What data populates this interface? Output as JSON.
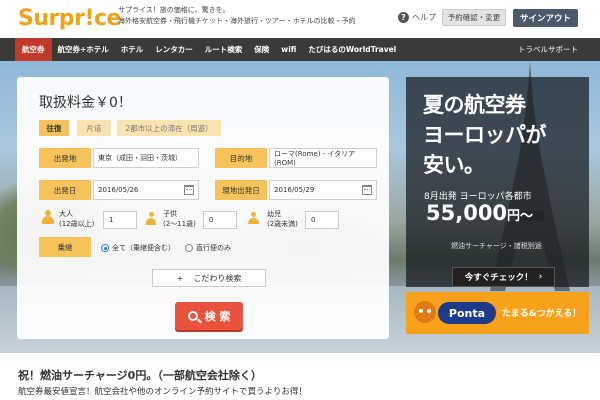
{
  "header": {
    "logo": "Surpr!ce",
    "tagline_1": "サプライス！旅の価格に、驚きを。",
    "tagline_2": "海外格安航空券・飛行機チケット・海外旅行・ツアー・ホテルの比較・予約",
    "help": "ヘルプ",
    "booking_button": "予約確認・変更",
    "signout_button": "サインアウト"
  },
  "nav": {
    "items": [
      "航空券",
      "航空券+ホテル",
      "ホテル",
      "レンタカー",
      "ルート検索",
      "保険",
      "wifi",
      "たびはるのWorldTravel"
    ],
    "support": "トラベルサポート"
  },
  "search": {
    "price_title": "取扱料金￥0！",
    "trip_tabs": [
      "往復",
      "片道",
      "2都市以上の滞在（周遊）"
    ],
    "depart_label": "出発地",
    "depart_value": "東京（成田・羽田・茨城）",
    "dest_label": "目的地",
    "dest_value": "ローマ(Rome) - イタリア(ROM)",
    "depart_date_label": "出発日",
    "depart_date_value": "2016/05/26",
    "local_date_label": "現地出発日",
    "local_date_value": "2016/05/29",
    "adult_label": "大人",
    "adult_sub": "(12歳以上)",
    "adult_value": "1",
    "child_label": "子供",
    "child_sub": "(2〜11歳)",
    "child_value": "0",
    "infant_label": "幼児",
    "infant_sub": "(2歳未満)",
    "infant_value": "0",
    "transfer_label": "乗継",
    "radio_all": "全て（乗継便含む）",
    "radio_direct": "直行便のみ",
    "detail_button": "こだわり検索",
    "detail_plus": "+",
    "search_button": "検 索"
  },
  "promo": {
    "line1": "夏の航空券",
    "line2": "ヨーロッパが",
    "line3": "安い。",
    "sub": "8月出発 ヨーロッパ各都市",
    "price": "55,000",
    "price_unit": "円〜",
    "note": "燃油サーチャージ・諸税別途",
    "button": "今すぐチェック！",
    "button_arrow": "›"
  },
  "ponta": {
    "logo": "Ponta",
    "text": "たまる&つかえる！"
  },
  "bottom": {
    "title": "祝！燃油サーチャージ0円。（一部航空会社除く）",
    "sub": "航空券最安値宣言！航空会社や他のオンライン予約サイトで買うよりお得！"
  },
  "colors": {
    "brand": "#f0a21b",
    "nav_active": "#c0392b",
    "label_bg": "#f6c25a",
    "search_btn": "#e9523c",
    "ponta": "#f7a21a"
  }
}
